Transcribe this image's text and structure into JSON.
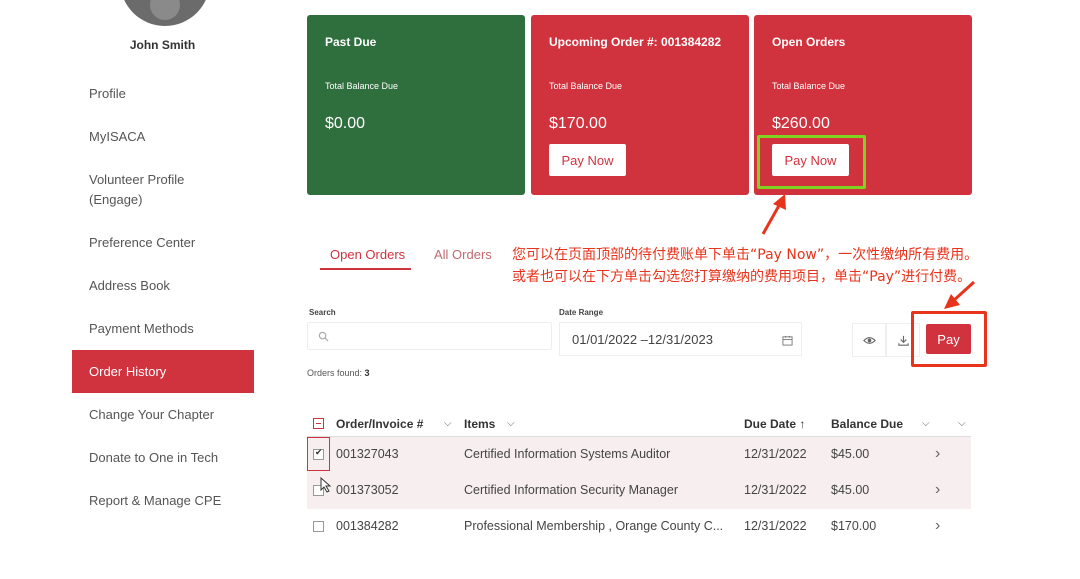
{
  "user": {
    "name": "John Smith"
  },
  "sidebar": {
    "items": [
      {
        "label": "Profile"
      },
      {
        "label": "MyISACA"
      },
      {
        "label": "Volunteer Profile (Engage)"
      },
      {
        "label": "Preference Center"
      },
      {
        "label": "Address Book"
      },
      {
        "label": "Payment Methods"
      },
      {
        "label": "Order History",
        "active": true
      },
      {
        "label": "Change Your Chapter"
      },
      {
        "label": "Donate to One in Tech"
      },
      {
        "label": "Report & Manage CPE"
      }
    ]
  },
  "cards": [
    {
      "title": "Past Due",
      "subtitle": "Total Balance Due",
      "amount": "$0.00",
      "color": "#2f6f3e"
    },
    {
      "title": "Upcoming Order #: 001384282",
      "subtitle": "Total Balance Due",
      "amount": "$170.00",
      "button": "Pay Now",
      "color": "#d0323e"
    },
    {
      "title": "Open Orders",
      "subtitle": "Total Balance Due",
      "amount": "$260.00",
      "button": "Pay Now",
      "color": "#d0323e"
    }
  ],
  "tabs": [
    {
      "label": "Open Orders",
      "active": true
    },
    {
      "label": "All Orders"
    }
  ],
  "annotation": {
    "line1": "您可以在页面顶部的待付费账单下单击“Pay Now”，一次性缴纳所有费用。",
    "line2": "或者也可以在下方单击勾选您打算缴纳的费用项目，单击“Pay”进行付费。"
  },
  "filters": {
    "search_label": "Search",
    "search_placeholder": "",
    "date_label": "Date Range",
    "date_value": "01/01/2022 –12/31/2023",
    "pay_label": "Pay"
  },
  "orders_found": {
    "label": "Orders found:",
    "count": "3"
  },
  "table": {
    "headers": {
      "order": "Order/Invoice #",
      "items": "Items",
      "due_date": "Due Date ↑",
      "balance": "Balance Due"
    },
    "rows": [
      {
        "order": "001327043",
        "item": "Certified Information Systems Auditor",
        "due": "12/31/2022",
        "balance": "$45.00",
        "checked": true
      },
      {
        "order": "001373052",
        "item": "Certified Information Security Manager",
        "due": "12/31/2022",
        "balance": "$45.00",
        "checked": false
      },
      {
        "order": "001384282",
        "item": "Professional Membership , Orange County C...",
        "due": "12/31/2022",
        "balance": "$170.00",
        "checked": false
      }
    ]
  },
  "colors": {
    "accent": "#d0323e",
    "success": "#2f6f3e",
    "highlight_green": "#7ed321",
    "annotation": "#e8341c"
  }
}
